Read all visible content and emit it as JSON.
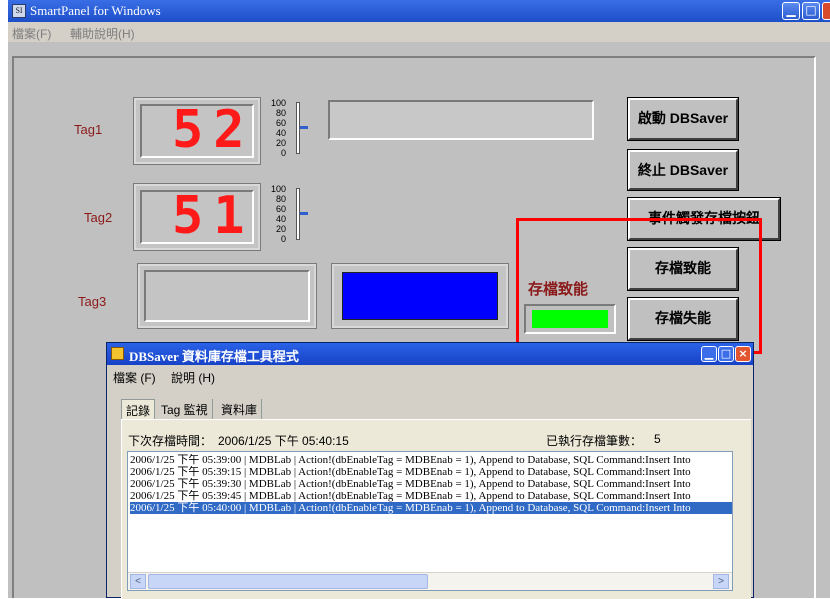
{
  "window": {
    "title": "SmartPanel for Windows",
    "icon_label": "SI",
    "menu": [
      "檔案(F)",
      "輔助說明(H)"
    ],
    "title_buttons": [
      "minimize-icon",
      "maximize-icon",
      "close-icon"
    ]
  },
  "panel": {
    "tags": [
      {
        "label": "Tag1",
        "display": "52",
        "gauge_ticks": [
          "100",
          "80",
          "60",
          "40",
          "20",
          "0"
        ],
        "gauge_level": 52
      },
      {
        "label": "Tag2",
        "display": "51",
        "gauge_ticks": [
          "100",
          "80",
          "60",
          "40",
          "20",
          "0"
        ],
        "gauge_level": 51
      },
      {
        "label": "Tag3"
      }
    ],
    "buttons": {
      "start": "啟動 DBSaver",
      "stop": "終止 DBSaver",
      "event": "事件觸發存檔按鈕",
      "enable": "存檔致能",
      "disable": "存檔失能"
    },
    "save_status_label": "存檔致能",
    "colors": {
      "lcd_digit": "#ff1a1a",
      "tag3_swatch": "#0000ff",
      "status_led": "#00ff00",
      "label_text": "#8b1a1a",
      "highlight_frame": "#ff0000"
    }
  },
  "dbsaver": {
    "title": "DBSaver 資料庫存檔工具程式",
    "menu": [
      "檔案 (F)",
      "說明 (H)"
    ],
    "tabs": [
      "記錄",
      "Tag 監視",
      "資料庫"
    ],
    "active_tab": "記錄",
    "next_save_label": "下次存檔時間：",
    "next_save_time": "2006/1/25 下午 05:40:15",
    "executed_label": "已執行存檔筆數：",
    "executed_count": "5",
    "log": [
      "2006/1/25 下午 05:39:00 | MDBLab | Action!(dbEnableTag = MDBEnab = 1),  Append to Database, SQL Command:Insert Into",
      "2006/1/25 下午 05:39:15 | MDBLab | Action!(dbEnableTag = MDBEnab = 1),  Append to Database, SQL Command:Insert Into",
      "2006/1/25 下午 05:39:30 | MDBLab | Action!(dbEnableTag = MDBEnab = 1),  Append to Database, SQL Command:Insert Into",
      "2006/1/25 下午 05:39:45 | MDBLab | Action!(dbEnableTag = MDBEnab = 1),  Append to Database, SQL Command:Insert Into",
      "2006/1/25 下午 05:40:00 | MDBLab | Action!(dbEnableTag = MDBEnab = 1),  Append to Database, SQL Command:Insert Into"
    ],
    "selected_log_index": 4,
    "scroll_left": "<",
    "scroll_right": ">"
  }
}
